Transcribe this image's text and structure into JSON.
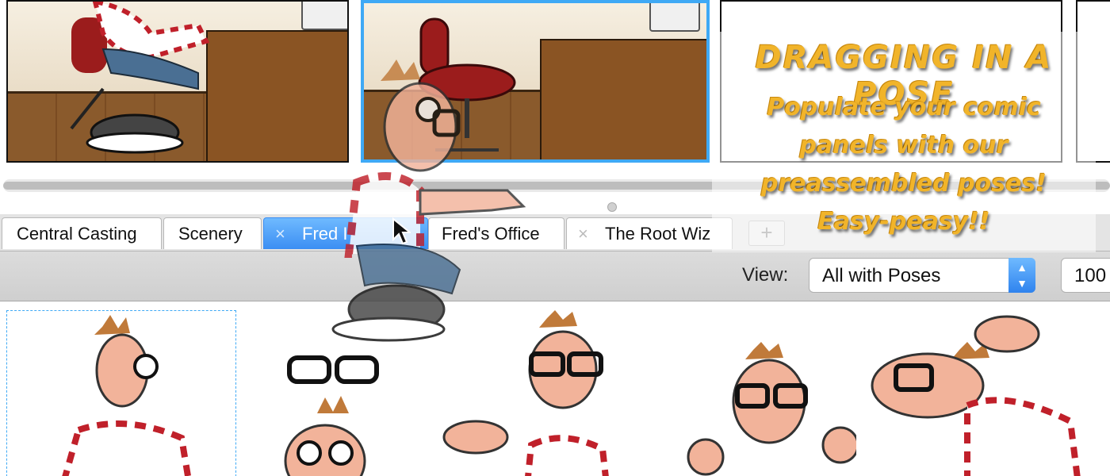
{
  "tabs": [
    {
      "label": "Central Casting",
      "closable": false,
      "selected": false
    },
    {
      "label": "Scenery",
      "closable": false,
      "selected": false
    },
    {
      "label": "Fred I",
      "closable": true,
      "selected": true
    },
    {
      "label": "Fred's Office",
      "closable": false,
      "selected": false
    },
    {
      "label": "The Root Wiz",
      "closable": true,
      "selected": false
    }
  ],
  "tab_close_glyph": "×",
  "add_tab_glyph": "+",
  "view": {
    "label": "View:",
    "selected": "All with Poses",
    "zoom": "100"
  },
  "promo": {
    "title": "DRAGGING IN A POSE",
    "lines": [
      "Populate your comic",
      "panels with our",
      "preassembled poses!",
      "Easy-peasy!!"
    ]
  },
  "colors": {
    "accent": "#3fa9f5",
    "selected_tab": "#3b8ef3",
    "promo_text": "#f1b42a"
  },
  "icons": [
    "close-icon",
    "plus-icon",
    "select-arrows-icon",
    "cursor-arrow-icon"
  ]
}
